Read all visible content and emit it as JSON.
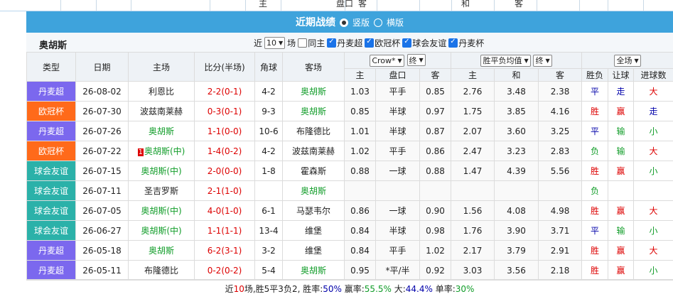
{
  "top_strip": {
    "labels": [
      "主",
      "盘口",
      "客",
      "和",
      "客"
    ]
  },
  "banner": {
    "title": "近期战绩",
    "option1": "竖版",
    "option2": "横版"
  },
  "section": {
    "team": "奥胡斯",
    "filter_prefix": "近",
    "count_value": "10",
    "filter_unit": "场",
    "same_host": "同主",
    "leagues": [
      "丹麦超",
      "欧冠杯",
      "球会友谊",
      "丹麦杯"
    ]
  },
  "headers": {
    "type": "类型",
    "date": "日期",
    "home": "主场",
    "score": "比分(半场)",
    "corner": "角球",
    "away": "客场",
    "company": "Crow*",
    "odds_type1": "终",
    "odds_label": "胜平负均值",
    "odds_type2": "终",
    "scope": "全场",
    "sub": [
      "主",
      "盘口",
      "客",
      "主",
      "和",
      "客",
      "胜负",
      "让球",
      "进球数"
    ]
  },
  "matches": [
    {
      "type": "丹麦超",
      "tc": "t-dk",
      "date": "26-08-02",
      "home": "利恩比",
      "hg": false,
      "hb": "",
      "score": "2-2",
      "half": "(0-1)",
      "corner": "4-2",
      "away": "奥胡斯",
      "ag": true,
      "h1": "1.03",
      "hl": "平手",
      "h2": "0.85",
      "o1": "2.76",
      "o2": "3.48",
      "o3": "2.38",
      "r": "平",
      "rc": "rd",
      "p": "走",
      "pc": "pd",
      "b": "大",
      "bc": "bw"
    },
    {
      "type": "欧冠杯",
      "tc": "t-ou",
      "date": "26-07-30",
      "home": "波兹南莱赫",
      "hg": false,
      "hb": "",
      "score": "0-3",
      "half": "(0-1)",
      "corner": "9-3",
      "away": "奥胡斯",
      "ag": true,
      "h1": "0.85",
      "hl": "半球",
      "h2": "0.97",
      "o1": "1.75",
      "o2": "3.85",
      "o3": "4.16",
      "r": "胜",
      "rc": "rw",
      "p": "赢",
      "pc": "pw",
      "b": "走",
      "bc": "bz"
    },
    {
      "type": "丹麦超",
      "tc": "t-dk",
      "date": "26-07-26",
      "home": "奥胡斯",
      "hg": true,
      "hb": "",
      "score": "1-1",
      "half": "(0-0)",
      "corner": "10-6",
      "away": "布隆德比",
      "ag": false,
      "h1": "1.01",
      "hl": "半球",
      "h2": "0.87",
      "o1": "2.07",
      "o2": "3.60",
      "o3": "3.25",
      "r": "平",
      "rc": "rd",
      "p": "输",
      "pc": "pl",
      "b": "小",
      "bc": "bs"
    },
    {
      "type": "欧冠杯",
      "tc": "t-ou",
      "date": "26-07-22",
      "home": "奥胡斯(中)",
      "hg": true,
      "hb": "1",
      "score": "1-4",
      "half": "(0-2)",
      "corner": "4-2",
      "away": "波兹南莱赫",
      "ag": false,
      "h1": "1.02",
      "hl": "平手",
      "h2": "0.86",
      "o1": "2.47",
      "o2": "3.23",
      "o3": "2.83",
      "r": "负",
      "rc": "rl",
      "p": "输",
      "pc": "pl",
      "b": "大",
      "bc": "bw"
    },
    {
      "type": "球会友谊",
      "tc": "t-cf",
      "date": "26-07-15",
      "home": "奥胡斯(中)",
      "hg": true,
      "hb": "",
      "score": "2-0",
      "half": "(0-0)",
      "corner": "1-8",
      "away": "霍森斯",
      "ag": false,
      "h1": "0.88",
      "hl": "一球",
      "h2": "0.88",
      "o1": "1.47",
      "o2": "4.39",
      "o3": "5.56",
      "r": "胜",
      "rc": "rw",
      "p": "赢",
      "pc": "pw",
      "b": "小",
      "bc": "bs"
    },
    {
      "type": "球会友谊",
      "tc": "t-cf",
      "date": "26-07-11",
      "home": "圣吉罗斯",
      "hg": false,
      "hb": "",
      "score": "2-1",
      "half": "(1-0)",
      "corner": "",
      "away": "奥胡斯",
      "ag": true,
      "h1": "",
      "hl": "",
      "h2": "",
      "o1": "",
      "o2": "",
      "o3": "",
      "r": "负",
      "rc": "rl",
      "p": "",
      "pc": "",
      "b": "",
      "bc": ""
    },
    {
      "type": "球会友谊",
      "tc": "t-cf",
      "date": "26-07-05",
      "home": "奥胡斯(中)",
      "hg": true,
      "hb": "",
      "score": "4-0",
      "half": "(1-0)",
      "corner": "6-1",
      "away": "马瑟韦尔",
      "ag": false,
      "h1": "0.86",
      "hl": "一球",
      "h2": "0.90",
      "o1": "1.56",
      "o2": "4.08",
      "o3": "4.98",
      "r": "胜",
      "rc": "rw",
      "p": "赢",
      "pc": "pw",
      "b": "大",
      "bc": "bw"
    },
    {
      "type": "球会友谊",
      "tc": "t-cf",
      "date": "26-06-27",
      "home": "奥胡斯(中)",
      "hg": true,
      "hb": "",
      "score": "1-1",
      "half": "(1-1)",
      "corner": "13-4",
      "away": "维堡",
      "ag": false,
      "h1": "0.84",
      "hl": "半球",
      "h2": "0.98",
      "o1": "1.76",
      "o2": "3.90",
      "o3": "3.71",
      "r": "平",
      "rc": "rd",
      "p": "输",
      "pc": "pl",
      "b": "小",
      "bc": "bs"
    },
    {
      "type": "丹麦超",
      "tc": "t-dk",
      "date": "26-05-18",
      "home": "奥胡斯",
      "hg": true,
      "hb": "",
      "score": "6-2",
      "half": "(3-1)",
      "corner": "3-2",
      "away": "维堡",
      "ag": false,
      "h1": "0.84",
      "hl": "平手",
      "h2": "1.02",
      "o1": "2.17",
      "o2": "3.79",
      "o3": "2.91",
      "r": "胜",
      "rc": "rw",
      "p": "赢",
      "pc": "pw",
      "b": "大",
      "bc": "bw"
    },
    {
      "type": "丹麦超",
      "tc": "t-dk",
      "date": "26-05-11",
      "home": "布隆德比",
      "hg": false,
      "hb": "",
      "score": "0-2",
      "half": "(0-2)",
      "corner": "5-4",
      "away": "奥胡斯",
      "ag": true,
      "h1": "0.95",
      "hl": "*平/半",
      "h2": "0.92",
      "o1": "3.03",
      "o2": "3.56",
      "o3": "2.18",
      "r": "胜",
      "rc": "rw",
      "p": "赢",
      "pc": "pw",
      "b": "小",
      "bc": "bs"
    }
  ],
  "footer": {
    "p1": "近",
    "n": "10",
    "p2": "场,胜5平3负2, 胜率:",
    "win": "50%",
    "p3": " 赢率:",
    "ying": "55.5%",
    "p4": " 大:",
    "da": "44.4%",
    "p5": " 单率:",
    "dan": "30%"
  }
}
